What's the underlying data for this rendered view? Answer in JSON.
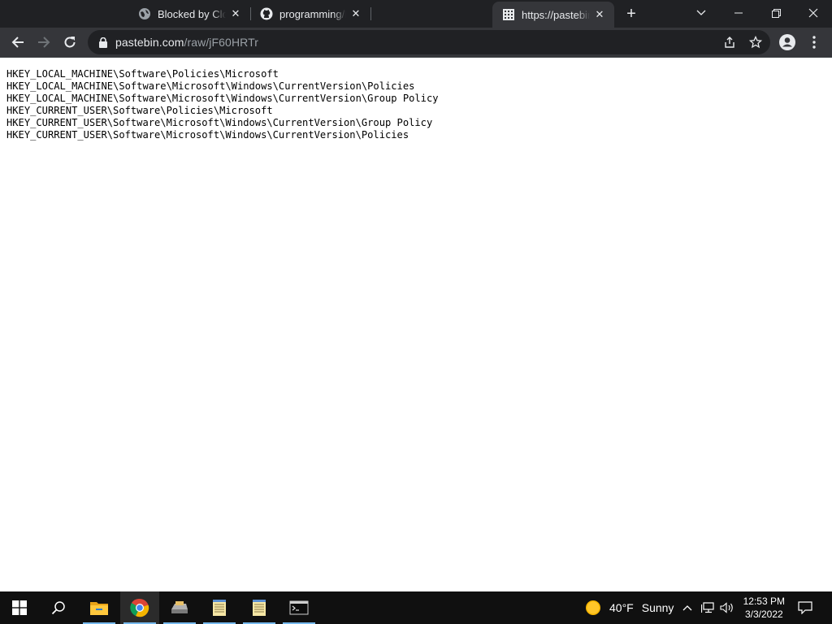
{
  "browser": {
    "tabs": [
      {
        "title": "Blocked by Clou",
        "favicon": "globe-icon",
        "active": false
      },
      {
        "title": "programming/D",
        "favicon": "github-icon",
        "active": false
      },
      {
        "title": "https://pastebin",
        "favicon": "pastebin-icon",
        "active": true
      }
    ],
    "new_tab_label": "+",
    "address": {
      "host": "pastebin.com",
      "path": "/raw/jF60HRTr"
    }
  },
  "page": {
    "lines": [
      "HKEY_LOCAL_MACHINE\\Software\\Policies\\Microsoft",
      "HKEY_LOCAL_MACHINE\\Software\\Microsoft\\Windows\\CurrentVersion\\Policies",
      "HKEY_LOCAL_MACHINE\\Software\\Microsoft\\Windows\\CurrentVersion\\Group Policy",
      "HKEY_CURRENT_USER\\Software\\Policies\\Microsoft",
      "HKEY_CURRENT_USER\\Software\\Microsoft\\Windows\\CurrentVersion\\Group Policy",
      "HKEY_CURRENT_USER\\Software\\Microsoft\\Windows\\CurrentVersion\\Policies"
    ]
  },
  "taskbar": {
    "pinned": [
      "windows-start-icon",
      "search-icon",
      "file-explorer-icon",
      "chrome-icon",
      "drive-icon",
      "notepad-icon",
      "notepad-icon",
      "command-prompt-icon"
    ],
    "weather": {
      "temp": "40°F",
      "condition": "Sunny"
    },
    "clock": {
      "time": "12:53 PM",
      "date": "3/3/2022"
    }
  },
  "colors": {
    "tab_bg": "#202124",
    "toolbar_bg": "#35363a",
    "taskbar_bg": "#101010",
    "accent": "#76b9ed"
  }
}
